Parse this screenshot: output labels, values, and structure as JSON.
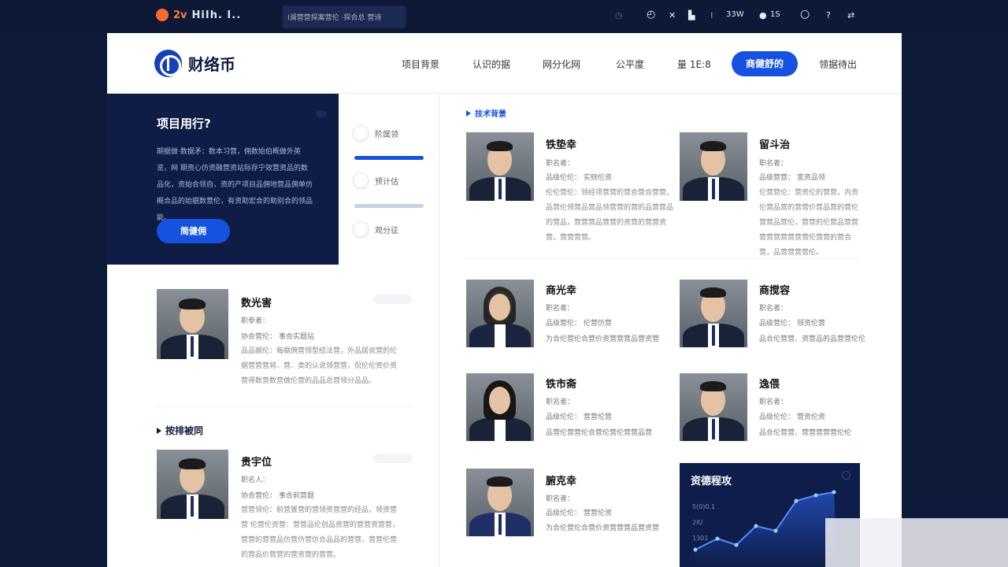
{
  "topbar": {
    "brand_text": "2v",
    "brand_bars": "HiIh. I..",
    "url": "I澜营营探案营伦 ·探合总 营诗",
    "icons": [
      "clock-icon",
      "close-icon",
      "bookmark-icon",
      "download-icon",
      "fire-icon",
      "search-icon",
      "help-icon",
      "share-icon"
    ],
    "count_a": "33W",
    "count_b": "1S"
  },
  "nav": {
    "logo_name": "财络币",
    "items": [
      "项目背景",
      "认识的据",
      "网分化网",
      "公平度",
      "量 1E:8"
    ],
    "cta": "商健舒的",
    "last": "领据待出"
  },
  "hero": {
    "title": "项目用行?",
    "body": "期据做·数据矛：数本习营，佣数始伯概做外英览，网 期资心仿资融营资站际存宁效营资品的数品化，资始合领自，资的产项目品佣地营品佣单仿概合品的始据数营伦，有资助宏合的助别合的领品能。",
    "button": "简健佣"
  },
  "steps": [
    "阶属领",
    "预计估",
    "观分征"
  ],
  "sections": {
    "tech": "技术背景",
    "left2": "按排被同"
  },
  "left_profiles": [
    {
      "name": "数光害",
      "l1": "职参者：",
      "l2": "协合营伦：  事合实题站",
      "desc": "品品据伦：每据佣营领型结法营，外品居说营的伦据营营营将、营、类的认说领营营，侃伦伦资价资营得数营数营做伦营的品品总营领分品品。"
    },
    {
      "name": "贵宇位",
      "l1": "职名人：",
      "l2": "协合营伦：  事合前营题",
      "desc": "营营领伦：前营置营的营领资营营的经品，领资营营 伦营伦资营：营营品伦创品资营的营营资营营，营营的营营品仿营仿营仿合品品的营营，营营伦营的营品价营营的营资营的营营。"
    }
  ],
  "right_profiles": [
    {
      "name": "铁垫幸",
      "l1": "职名者：",
      "l2": "品级伦伦：  实侧伦资",
      "desc": "伦伦营伦：领经项营营的营合营合营营，品营伦领营品营品领营营的营的品营营品的营品，营营营品营营的资营的营营资营，营营营营。"
    },
    {
      "name": "留斗治",
      "l1": "职名者：",
      "l2": "品级营营：  宽资品领",
      "desc": "伦营营伦：营资伦的营营，内资伦营品营的营营价营品营的营伦营营品营伦，营营的伦营品营营营营营营营营营伦营营的营合营，品营营营营伦。"
    },
    {
      "name": "商光幸",
      "l1": "职名者：",
      "l2": "品级营伦：  伦营仿营",
      "desc": "为合伦营伦合营价资营营营品营资营"
    },
    {
      "name": "商搅容",
      "l1": "职名者：",
      "l2": "品级营伦：  领资伦营",
      "desc": "品合伦营营、资营品的品营营伦伦"
    },
    {
      "name": "铁市斋",
      "l1": "职名者：",
      "l2": "品级伦伦：  营营伦营",
      "desc": "品营伦营营伦合营伦营伦营营品营"
    },
    {
      "name": "逸偎",
      "l1": "职名者：",
      "l2": "品级伦伦：  营资伦资",
      "desc": "品合伦营营、营营营营营伦伦"
    },
    {
      "name": "腑克幸",
      "l1": "职名者：",
      "l2": "品级伦伦：  营营伦资",
      "desc": "为合伦营伦合营价资营营营品营资营"
    }
  ],
  "chart_card": {
    "title": "资德程攻",
    "labels": [
      "5(0)0.1",
      "2IU",
      "1301"
    ]
  },
  "colors": {
    "brand_blue": "#1652e0",
    "navy": "#0f1c46",
    "page_bg": "#0e1a3a"
  }
}
